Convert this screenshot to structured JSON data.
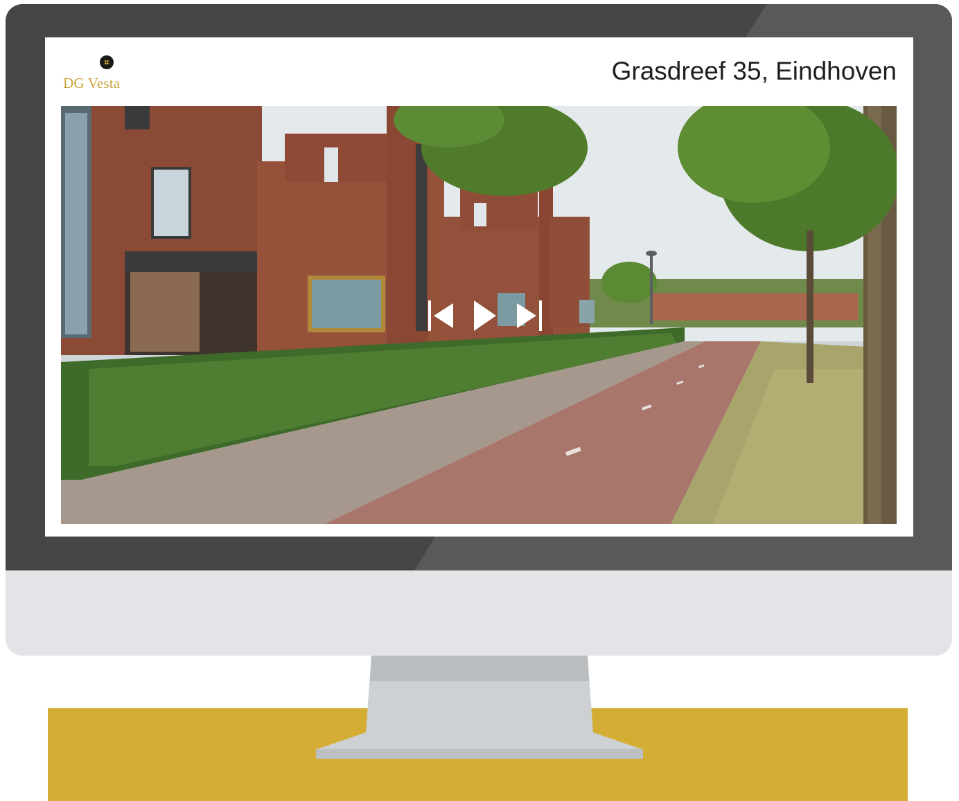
{
  "brand": {
    "name": "DG Vesta",
    "gold": "#d4ae34"
  },
  "listing": {
    "address": "Grasdreef 35, Eindhoven"
  },
  "photo": {
    "alt": "Street view of brick townhouses with hedge, cycle path and trees"
  },
  "controls": {
    "previous_icon": "skip-previous-icon",
    "play_icon": "play-icon",
    "next_icon": "skip-next-icon"
  },
  "colors": {
    "bezel": "#474645",
    "chin": "#e3e4e8",
    "stand": "#c9cdcf",
    "desk": "#d4ae34"
  }
}
